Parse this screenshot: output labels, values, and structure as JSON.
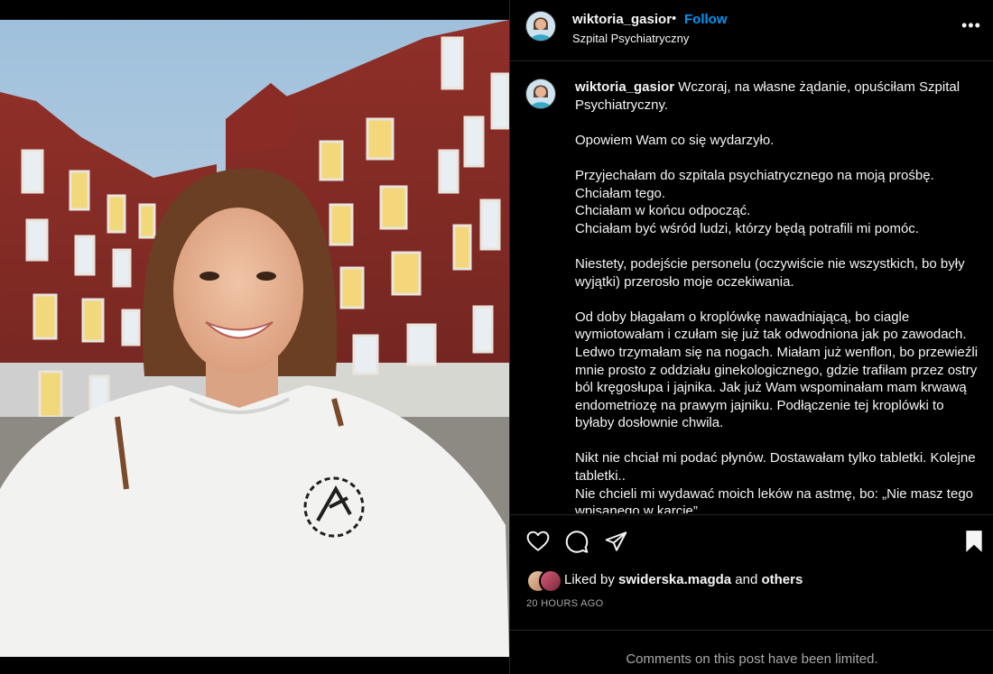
{
  "post": {
    "username": "wiktoria_gasior",
    "separator": "•",
    "follow_label": "Follow",
    "location": "Szpital Psychiatryczny",
    "more_label": "•••"
  },
  "caption": {
    "username": "wiktoria_gasior",
    "paragraphs": [
      "Wczoraj, na własne żądanie, opuściłam Szpital Psychiatryczny.",
      "Opowiem Wam co się wydarzyło.",
      "Przyjechałam do szpitala psychiatrycznego na moją prośbę.\nChciałam tego.\nChciałam w końcu odpocząć.\nChciałam być wśród ludzi, którzy będą potrafili mi pomóc.",
      "Niestety, podejście personelu (oczywiście nie wszystkich, bo były wyjątki) przerosło moje oczekiwania.",
      "Od doby błagałam o kroplówkę nawadniającą, bo ciagle wymiotowałam i czułam się już tak odwodniona jak po zawodach. Ledwo trzymałam się na nogach. Miałam już wenflon, bo przewieźli mnie prosto z oddziału ginekologicznego, gdzie trafiłam przez ostry ból kręgosłupa i jajnika. Jak już Wam wspominałam mam krwawą endometriozę na prawym jajniku. Podłączenie tej kroplówki to byłaby dosłownie chwila.",
      "Nikt nie chciał mi podać płynów. Dostawałam tylko tabletki. Kolejne tabletki..\nNie chcieli mi wydawać moich leków na astmę, bo: „Nie masz tego wpisanego w karcie”"
    ]
  },
  "actions": {
    "like_icon": "heart-icon",
    "comment_icon": "comment-icon",
    "share_icon": "share-icon",
    "save_icon": "bookmark-icon"
  },
  "likes": {
    "prefix": "Liked by ",
    "user": "swiderska.magda",
    "middle": " and ",
    "others": "others"
  },
  "time_ago": "20 HOURS AGO",
  "comments_limited": "Comments on this post have been limited.",
  "colors": {
    "background": "#000000",
    "text": "#f5f5f5",
    "accent": "#0095f6",
    "muted": "#a8a8a8",
    "divider": "#262626"
  }
}
